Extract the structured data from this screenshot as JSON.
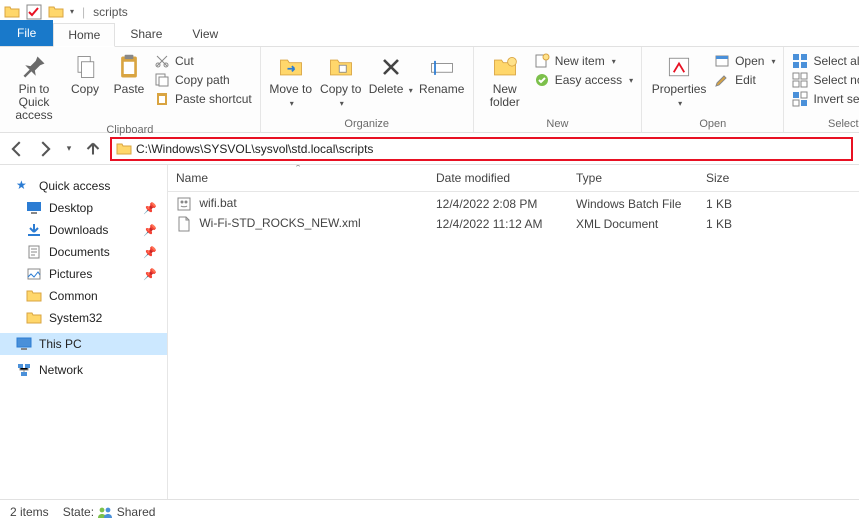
{
  "title": "scripts",
  "tabs": {
    "file": "File",
    "home": "Home",
    "share": "Share",
    "view": "View"
  },
  "ribbon": {
    "pin": "Pin to Quick access",
    "copy": "Copy",
    "paste": "Paste",
    "cut": "Cut",
    "copypath": "Copy path",
    "pasteshortcut": "Paste shortcut",
    "clipboard": "Clipboard",
    "moveto": "Move to",
    "copyto": "Copy to",
    "delete": "Delete",
    "rename": "Rename",
    "organize": "Organize",
    "newfolder": "New folder",
    "newitem": "New item",
    "easyaccess": "Easy access",
    "new": "New",
    "properties": "Properties",
    "open": "Open",
    "edit": "Edit",
    "opengroup": "Open",
    "selectall": "Select all",
    "selectnone": "Select none",
    "invert": "Invert selection",
    "select": "Select"
  },
  "address": "C:\\Windows\\SYSVOL\\sysvol\\std.local\\scripts",
  "columns": {
    "name": "Name",
    "date": "Date modified",
    "type": "Type",
    "size": "Size"
  },
  "sidebar": {
    "quick": "Quick access",
    "desktop": "Desktop",
    "downloads": "Downloads",
    "documents": "Documents",
    "pictures": "Pictures",
    "common": "Common",
    "system32": "System32",
    "thispc": "This PC",
    "network": "Network"
  },
  "files": [
    {
      "name": "wifi.bat",
      "date": "12/4/2022 2:08 PM",
      "type": "Windows Batch File",
      "size": "1 KB"
    },
    {
      "name": "Wi-Fi-STD_ROCKS_NEW.xml",
      "date": "12/4/2022 11:12 AM",
      "type": "XML Document",
      "size": "1 KB"
    }
  ],
  "status": {
    "count": "2 items",
    "state_label": "State:",
    "state_value": "Shared"
  }
}
